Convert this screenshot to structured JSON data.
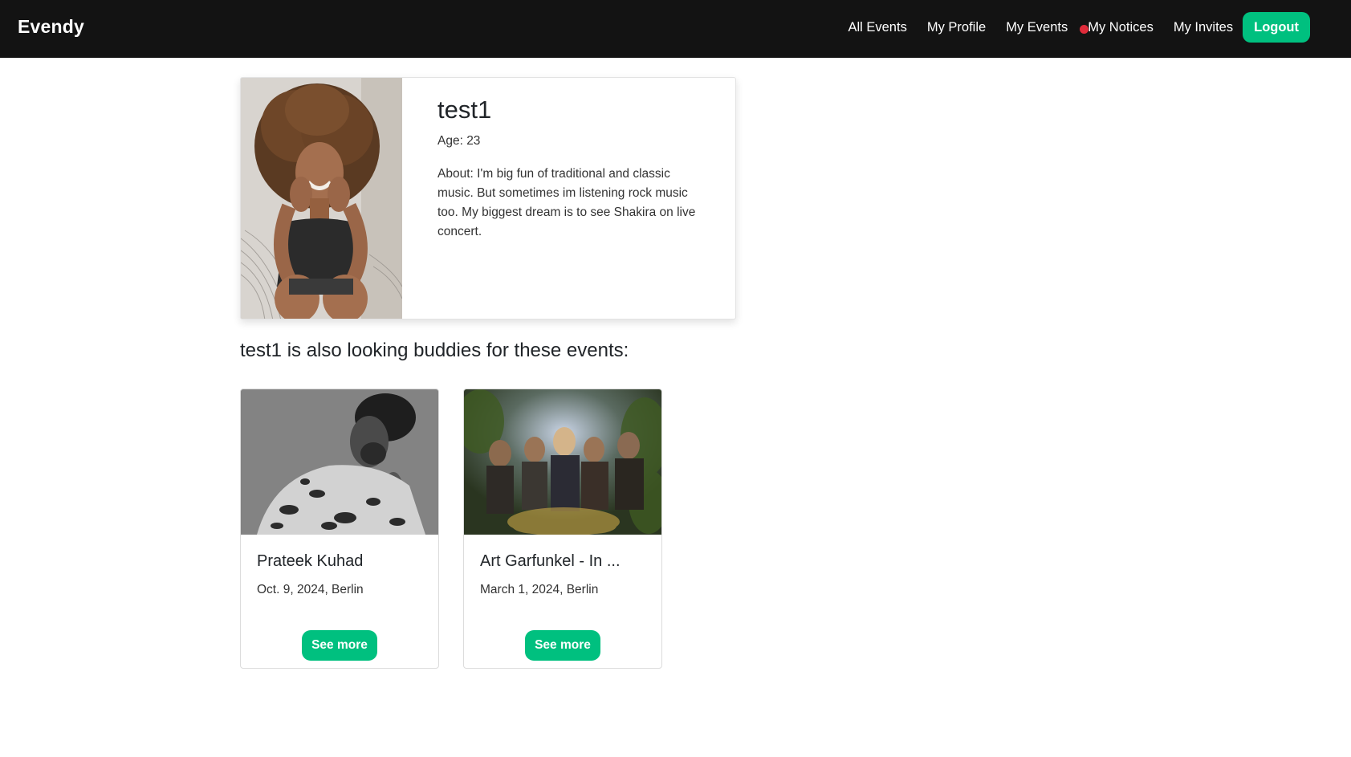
{
  "theme": {
    "navbar_bg": "#131313",
    "accent": "#00c07f",
    "notice_dot": "#e02b3a"
  },
  "navbar": {
    "brand": "Evendy",
    "links": {
      "all_events": "All Events",
      "my_profile": "My Profile",
      "my_events": "My Events",
      "my_notices": "My Notices",
      "my_invites": "My Invites"
    },
    "logout_label": "Logout"
  },
  "profile": {
    "name": "test1",
    "age": "Age: 23",
    "about": "About: I'm big fun of traditional and classic music. But sometimes im listening rock music too. My biggest dream is to see Shakira on live concert."
  },
  "events_section": {
    "heading": "test1 is also looking buddies for these events:",
    "events": [
      {
        "title": "Prateek Kuhad",
        "date": "Oct. 9, 2024, Berlin",
        "button_label": "See more"
      },
      {
        "title": "Art Garfunkel - In ...",
        "date": "March 1, 2024, Berlin",
        "button_label": "See more"
      }
    ]
  }
}
